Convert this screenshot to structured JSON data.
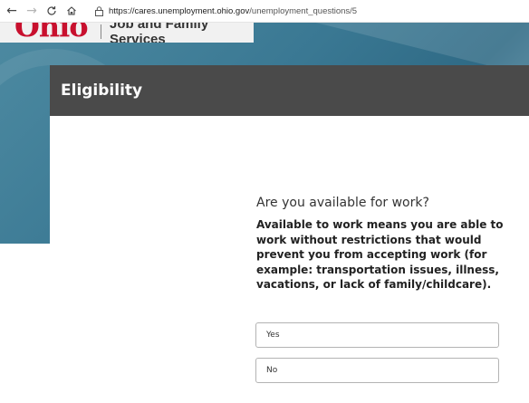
{
  "browser": {
    "url_host": "https://cares.unemployment.ohio.gov",
    "url_path": "/unemployment_questions/5",
    "icons": [
      "back-arrow-icon",
      "forward-arrow-icon",
      "refresh-icon",
      "home-icon",
      "lock-icon"
    ]
  },
  "logo": {
    "mark": "Ohio",
    "text": "Job and Family Services"
  },
  "page": {
    "title": "Eligibility",
    "question": "Are you available for work?",
    "help": "Available to work means you are able to work without restrictions that would prevent you from accepting work (for example: transportation issues, illness, vacations, or lack of family/childcare).",
    "options": [
      "Yes",
      "No"
    ]
  },
  "colors": {
    "header_bg": "#4a4a4a",
    "hero_bg": "#3a7893",
    "logo_red": "#c8102e"
  }
}
